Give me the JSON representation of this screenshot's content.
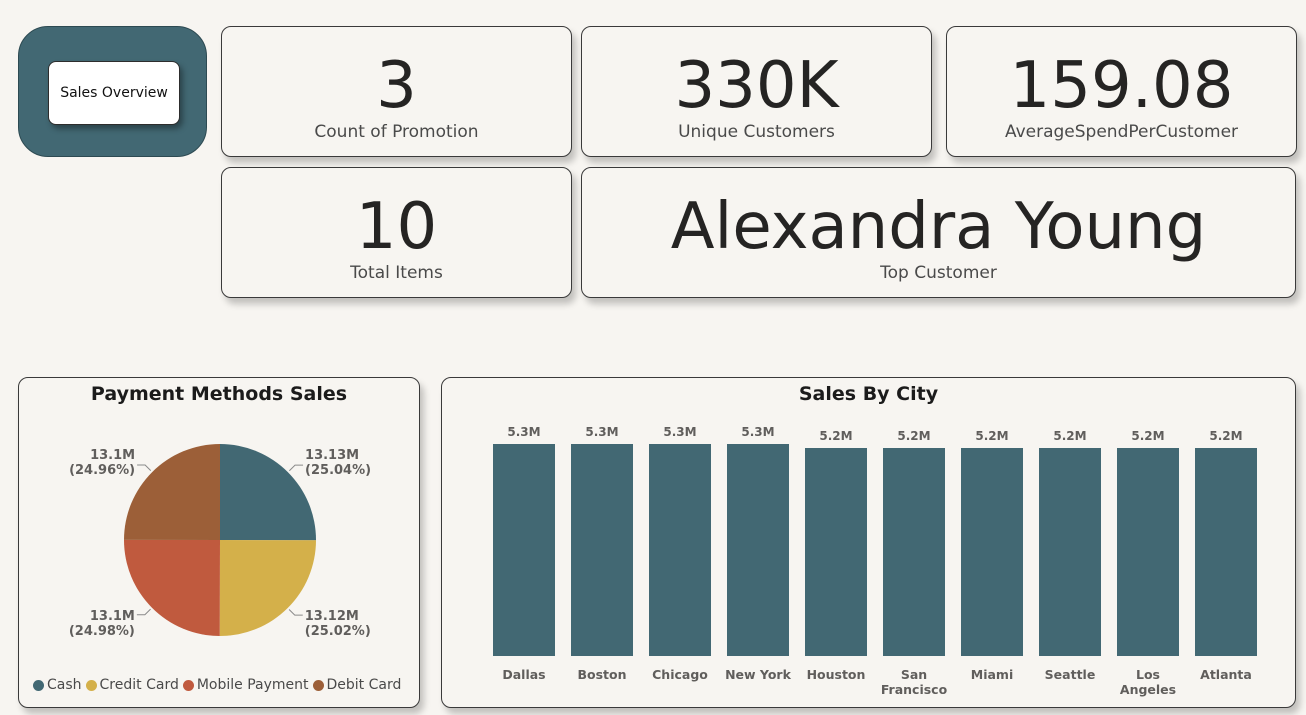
{
  "nav": {
    "button_label": "Sales Overview",
    "panel_color": "#426873"
  },
  "kpis": {
    "count_of_promotion": {
      "value": "3",
      "label": "Count of Promotion"
    },
    "unique_customers": {
      "value": "330K",
      "label": "Unique Customers"
    },
    "avg_spend": {
      "value": "159.08",
      "label": "AverageSpendPerCustomer"
    },
    "total_items": {
      "value": "10",
      "label": "Total Items"
    },
    "top_customer": {
      "value": "Alexandra Young",
      "label": "Top Customer"
    }
  },
  "chart_data": [
    {
      "type": "pie",
      "title": "Payment Methods Sales",
      "categories": [
        "Cash",
        "Credit Card",
        "Mobile Payment",
        "Debit Card"
      ],
      "values": [
        13.13,
        13.12,
        13.1,
        13.1
      ],
      "value_labels": [
        "13.13M",
        "13.12M",
        "13.1M",
        "13.1M"
      ],
      "percent_labels": [
        "(25.04%)",
        "(25.02%)",
        "(24.98%)",
        "(24.96%)"
      ],
      "units": "M",
      "colors": [
        "#426873",
        "#d4b04a",
        "#c05a3e",
        "#9c5f38"
      ],
      "legend_position": "bottom"
    },
    {
      "type": "bar",
      "title": "Sales By City",
      "categories": [
        "Dallas",
        "Boston",
        "Chicago",
        "New York",
        "Houston",
        "San Francisco",
        "Miami",
        "Seattle",
        "Los Angeles",
        "Atlanta"
      ],
      "category_lines": [
        [
          "Dallas"
        ],
        [
          "Boston"
        ],
        [
          "Chicago"
        ],
        [
          "New York"
        ],
        [
          "Houston"
        ],
        [
          "San",
          "Francisco"
        ],
        [
          "Miami"
        ],
        [
          "Seattle"
        ],
        [
          "Los",
          "Angeles"
        ],
        [
          "Atlanta"
        ]
      ],
      "values": [
        5.3,
        5.3,
        5.3,
        5.3,
        5.2,
        5.2,
        5.2,
        5.2,
        5.2,
        5.2
      ],
      "value_labels": [
        "5.3M",
        "5.3M",
        "5.3M",
        "5.3M",
        "5.2M",
        "5.2M",
        "5.2M",
        "5.2M",
        "5.2M",
        "5.2M"
      ],
      "units": "M",
      "color": "#426873",
      "grid": false
    }
  ]
}
